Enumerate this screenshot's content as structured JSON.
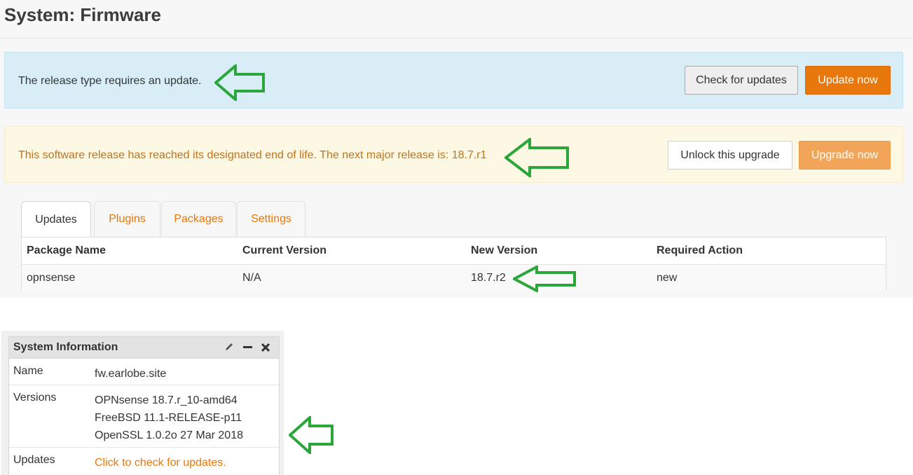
{
  "page": {
    "title": "System: Firmware"
  },
  "info_alert": {
    "text": "The release type requires an update.",
    "check_button": "Check for updates",
    "update_button": "Update now"
  },
  "warning_alert": {
    "text": "This software release has reached its designated end of life. The next major release is: 18.7.r1",
    "unlock_button": "Unlock this upgrade",
    "upgrade_button": "Upgrade now"
  },
  "tabs": [
    {
      "label": "Updates",
      "active": true
    },
    {
      "label": "Plugins",
      "active": false
    },
    {
      "label": "Packages",
      "active": false
    },
    {
      "label": "Settings",
      "active": false
    }
  ],
  "packages": {
    "columns": [
      "Package Name",
      "Current Version",
      "New Version",
      "Required Action"
    ],
    "rows": [
      [
        "opnsense",
        "N/A",
        "18.7.r2",
        "new"
      ]
    ]
  },
  "system_info": {
    "title": "System Information",
    "rows": [
      {
        "label": "Name",
        "value": "fw.earlobe.site"
      },
      {
        "label": "Versions",
        "lines": [
          "OPNsense 18.7.r_10-amd64",
          "FreeBSD 11.1-RELEASE-p11",
          "OpenSSL 1.0.2o 27 Mar 2018"
        ]
      },
      {
        "label": "Updates",
        "link": "Click to check for updates."
      }
    ]
  },
  "colors": {
    "accent": "#e8770c",
    "info_bg": "#d9edf7",
    "warning_bg": "#fcf8e3",
    "annotation_arrow": "#2aa63a"
  },
  "icons": {
    "annotation": "arrow-left-outline",
    "widget": [
      "pencil-icon",
      "minus-icon",
      "close-icon"
    ]
  }
}
